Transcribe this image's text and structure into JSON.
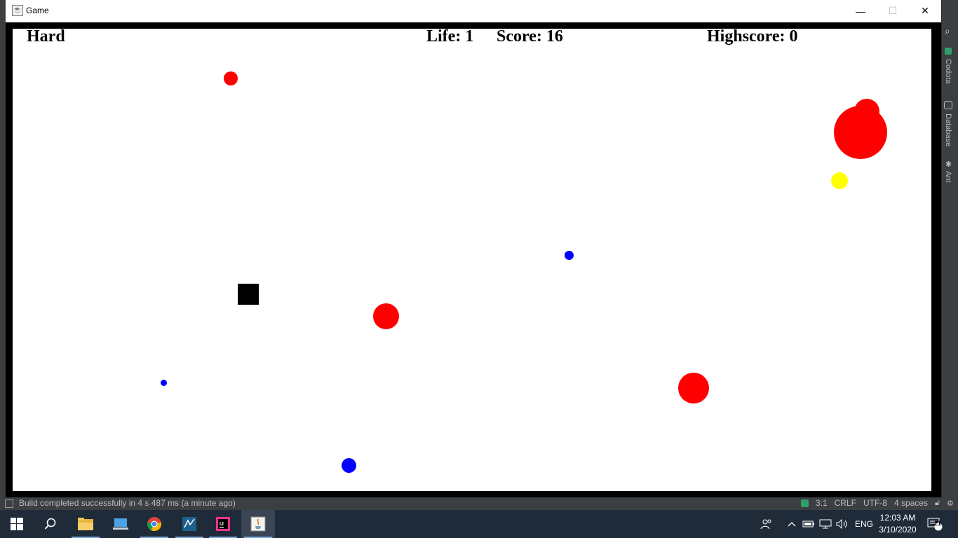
{
  "window": {
    "title": "Game",
    "minimize": "—",
    "maximize": "☐",
    "close": "✕"
  },
  "hud": {
    "difficulty": "Hard",
    "life": "Life: 1",
    "score": "Score: 16",
    "highscore": "Highscore: 0"
  },
  "game": {
    "colors": {
      "enemy": "#ff0000",
      "friendly": "#0000ff",
      "bonus": "#ffff00",
      "player": "#000000"
    }
  },
  "ide": {
    "tools": [
      "Codota",
      "Database",
      "Ant"
    ],
    "status_message": "Build completed successfully in 4 s 487 ms (a minute ago)",
    "position": "3:1",
    "line_separator": "CRLF",
    "encoding": "UTF-8",
    "indent": "4 spaces"
  },
  "taskbar": {
    "apps": [
      "start-icon",
      "search-icon",
      "file-explorer-icon",
      "computer-icon",
      "chrome-icon",
      "workbench-icon",
      "intellij-icon",
      "java-icon"
    ],
    "language": "ENG",
    "time": "12:03 AM",
    "date": "3/10/2020",
    "notifications": "21"
  }
}
